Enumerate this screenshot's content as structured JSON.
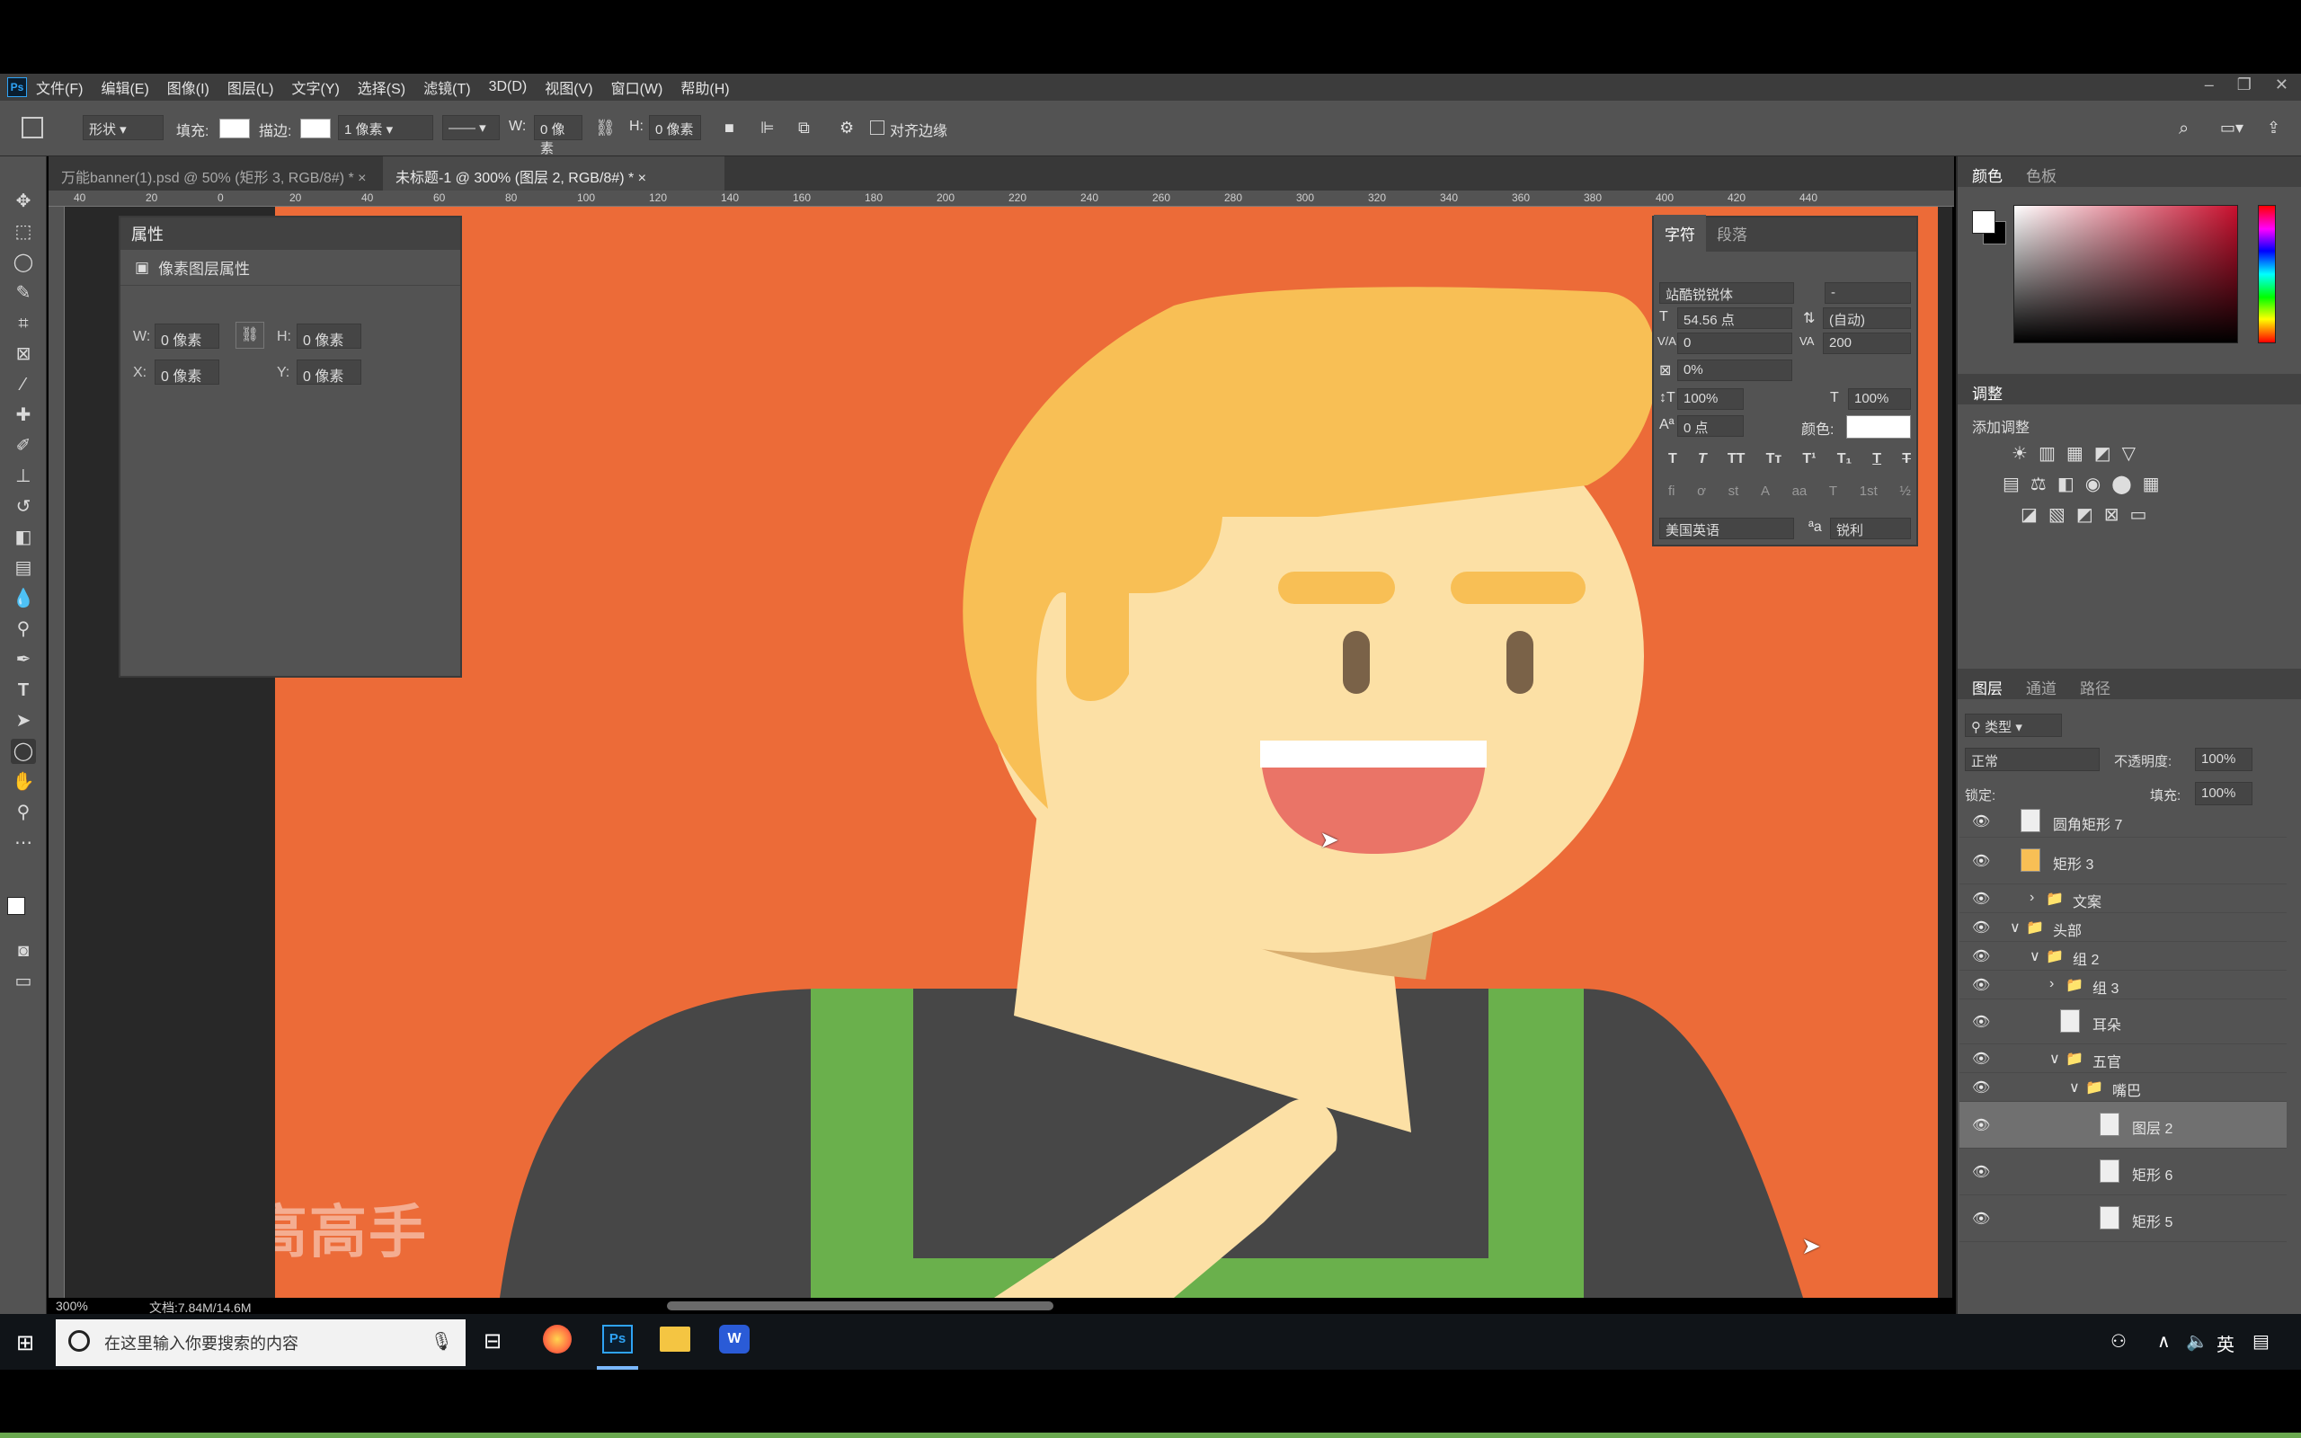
{
  "menubar": {
    "app_logo": "Ps",
    "items": [
      "文件(F)",
      "编辑(E)",
      "图像(I)",
      "图层(L)",
      "文字(Y)",
      "选择(S)",
      "滤镜(T)",
      "3D(D)",
      "视图(V)",
      "窗口(W)",
      "帮助(H)"
    ],
    "win_controls": [
      "–",
      "❐",
      "✕"
    ]
  },
  "options": {
    "mode": "形状",
    "fill_label": "填充:",
    "stroke_label": "描边:",
    "stroke_width": "1 像素",
    "w_label": "W:",
    "w_value": "0 像素",
    "h_label": "H:",
    "h_value": "0 像素",
    "align_edges": "对齐边缘"
  },
  "tabs": [
    {
      "label": "万能banner(1).psd @ 50% (矩形 3, RGB/8#) *"
    },
    {
      "label": "未标题-1 @ 300% (图层 2, RGB/8#) *"
    }
  ],
  "ruler_h": [
    "40",
    "20",
    "0",
    "20",
    "40",
    "60",
    "80",
    "100",
    "120",
    "140",
    "160",
    "180",
    "200",
    "220",
    "240",
    "260",
    "280",
    "300",
    "320",
    "340",
    "360",
    "380",
    "400",
    "420",
    "440"
  ],
  "properties_panel": {
    "title": "属性",
    "subtitle": "像素图层属性",
    "w_label": "W:",
    "w": "0 像素",
    "h_label": "H:",
    "h": "0 像素",
    "x_label": "X:",
    "x": "0 像素",
    "y_label": "Y:",
    "y": "0 像素"
  },
  "character_panel": {
    "tab_char": "字符",
    "tab_para": "段落",
    "font": "站酷锐锐体",
    "style": "-",
    "size": "54.56 点",
    "leading": "(自动)",
    "kerning": "0",
    "tracking": "200",
    "scale_pct": "0%",
    "vscale": "100%",
    "hscale": "100%",
    "baseline": "0 点",
    "color_label": "颜色:",
    "language": "美国英语",
    "aa_icon": "ªa",
    "antialias": "锐利",
    "style_buttons": [
      "T",
      "T",
      "TT",
      "Tт",
      "T¹",
      "T₁",
      "T",
      "T"
    ],
    "ot_buttons": [
      "fi",
      "ơ",
      "st",
      "A",
      "aa",
      "T",
      "1st",
      "½"
    ]
  },
  "color_panel": {
    "tab_color": "颜色",
    "tab_swatch": "色板"
  },
  "adjust_panel": {
    "title": "调整",
    "add": "添加调整"
  },
  "layers_panel": {
    "tab_layers": "图层",
    "tab_channels": "通道",
    "tab_paths": "路径",
    "filter": "类型",
    "blend": "正常",
    "opacity_label": "不透明度:",
    "opacity": "100%",
    "lock_label": "锁定:",
    "fill_label": "填充:",
    "fill": "100%",
    "rows": [
      {
        "name": "圆角矩形 7",
        "indent": 0,
        "kind": "layer"
      },
      {
        "name": "矩形 3",
        "indent": 0,
        "kind": "layer"
      },
      {
        "name": "文案",
        "indent": 1,
        "kind": "folder-closed"
      },
      {
        "name": "头部",
        "indent": 0,
        "kind": "folder-open"
      },
      {
        "name": "组 2",
        "indent": 1,
        "kind": "folder-open"
      },
      {
        "name": "组 3",
        "indent": 2,
        "kind": "folder-closed"
      },
      {
        "name": "耳朵",
        "indent": 2,
        "kind": "layer"
      },
      {
        "name": "五官",
        "indent": 2,
        "kind": "folder-open"
      },
      {
        "name": "嘴巴",
        "indent": 3,
        "kind": "folder-open"
      },
      {
        "name": "图层 2",
        "indent": 4,
        "kind": "layer",
        "selected": true
      },
      {
        "name": "矩形 6",
        "indent": 4,
        "kind": "layer"
      },
      {
        "name": "矩形 5",
        "indent": 4,
        "kind": "layer"
      }
    ]
  },
  "status": {
    "zoom": "300%",
    "doc": "文档:7.84M/14.6M"
  },
  "watermark": "站酷高高手",
  "taskbar": {
    "search_placeholder": "在这里输入你要搜索的内容",
    "tray_lang": "英"
  },
  "colors": {
    "canvas_orange": "#ec6b38",
    "hair": "#f8bf55",
    "skin": "#fce0a5",
    "shirt": "#474747",
    "strap_green": "#6ab04c",
    "mouth": "#ea7467"
  }
}
